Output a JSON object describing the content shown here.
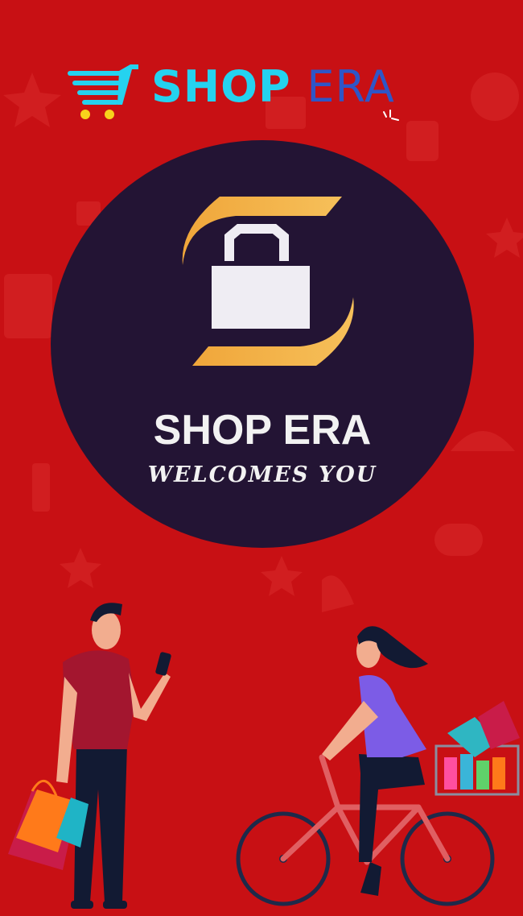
{
  "header": {
    "brand_word_1": "SHOP",
    "brand_word_2": "ERA",
    "logo_icon": "shopping-cart-icon"
  },
  "badge": {
    "title": "SHOP ERA",
    "subtitle": "WELCOMES YOU",
    "icon": "shopping-bag-icon"
  },
  "illustration": {
    "left_figure": "man-shopping-bags-icon",
    "right_figure": "woman-bicycle-icon"
  },
  "colors": {
    "background": "#c81014",
    "badge_background": "#231434",
    "brand_cyan": "#25d2ef",
    "brand_blue": "#2e56c7",
    "accent_gold": "#f2a93b"
  }
}
